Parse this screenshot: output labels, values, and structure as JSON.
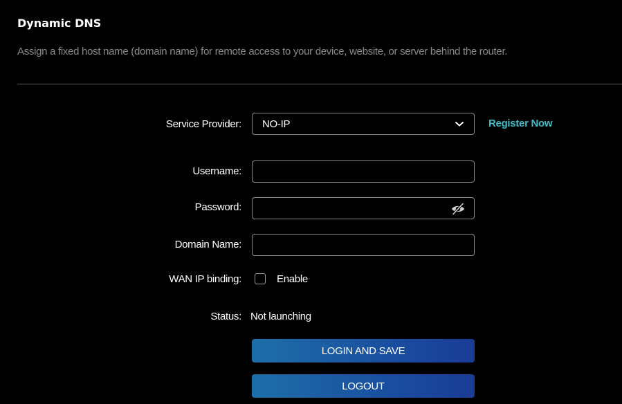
{
  "header": {
    "title": "Dynamic DNS",
    "description": "Assign a fixed host name (domain name) for remote access to your device, website, or server behind the router."
  },
  "form": {
    "service_provider": {
      "label": "Service Provider:",
      "value": "NO-IP",
      "icon": "chevron-down-icon",
      "register_link": "Register Now"
    },
    "username": {
      "label": "Username:",
      "value": ""
    },
    "password": {
      "label": "Password:",
      "value": "",
      "icon": "eye-slash-icon"
    },
    "domain_name": {
      "label": "Domain Name:",
      "value": ""
    },
    "wan_ip_binding": {
      "label": "WAN IP binding:",
      "checkbox_label": "Enable",
      "checked": false
    },
    "status": {
      "label": "Status:",
      "value": "Not launching"
    }
  },
  "buttons": {
    "login_save": "LOGIN AND SAVE",
    "logout": "LOGOUT"
  },
  "colors": {
    "background": "#000000",
    "link": "#3dbcc7",
    "description": "#8a8a8a",
    "button_start": "#1d6fa8",
    "button_end": "#1a3c96"
  }
}
